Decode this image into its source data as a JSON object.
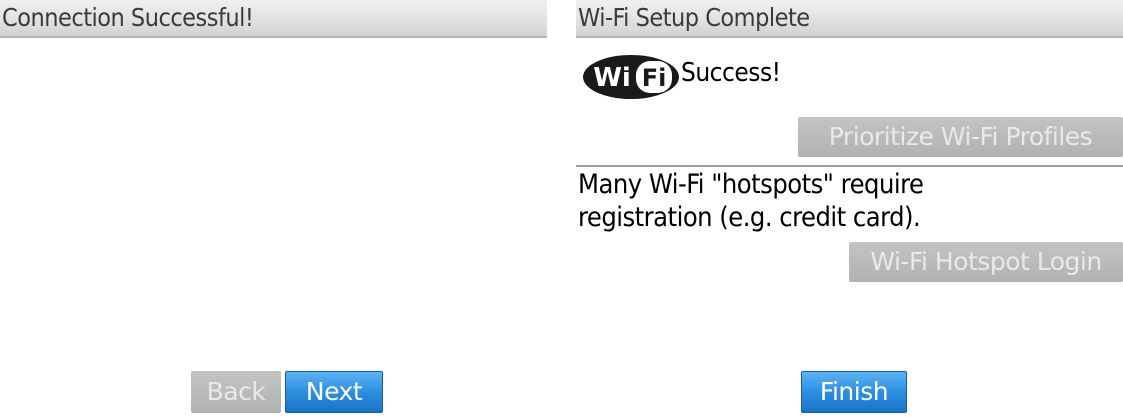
{
  "left_screen": {
    "title": "Connection Successful!",
    "back_label": "Back",
    "next_label": "Next"
  },
  "right_screen": {
    "title": "Wi-Fi Setup Complete",
    "logo_text_wi": "Wi",
    "logo_text_fi": "Fi",
    "success_text": "Success!",
    "prioritize_label": "Prioritize Wi-Fi Profiles",
    "info_line1": "Many Wi-Fi \"hotspots\" require",
    "info_line2": "registration (e.g. credit card).",
    "hotspot_login_label": "Wi-Fi Hotspot Login",
    "finish_label": "Finish"
  },
  "colors": {
    "primary_button": "#2d8fe0",
    "disabled_button": "#b8b8b8",
    "titlebar": "#e2e2e2"
  }
}
